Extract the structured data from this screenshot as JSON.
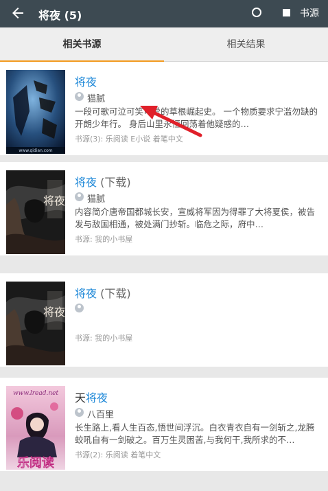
{
  "appbar": {
    "title": "将夜 (5)",
    "source_label": "书源"
  },
  "tabs": [
    {
      "label": "相关书源"
    },
    {
      "label": "相关结果"
    }
  ],
  "books": [
    {
      "name_prefix": "",
      "name_highlight": "将夜",
      "name_suffix": "",
      "author": "猫腻",
      "intro": "一段可歌可泣可笑可爱的草根崛起史。 一个物质要求宁滥勿缺的开朗少年行。 身后山里永恒回荡着他疑惑的…",
      "meta": "书源(3): 乐阅读 E小说 着笔中文",
      "cover_text": "www.qidian.com"
    },
    {
      "name_prefix": "",
      "name_highlight": "将夜",
      "name_suffix": " (下载)",
      "author": "猫腻",
      "intro": "内容简介唐帝国都城长安，宣威将军因为得罪了大将夏侯，被告发与敌国相通，被处满门抄斩。临危之际，府中…",
      "meta": "书源: 我的小书屋",
      "cover_text": "将夜"
    },
    {
      "name_prefix": "",
      "name_highlight": "将夜",
      "name_suffix": " (下载)",
      "author": "",
      "intro": "",
      "meta": "书源: 我的小书屋",
      "cover_text": "将夜"
    },
    {
      "name_prefix": "天",
      "name_highlight": "将夜",
      "name_suffix": "",
      "author": "八百里",
      "intro": "长生路上,看人生百态,悟世间浮沉。白衣青衣自有一剑斩之,龙腾蛟吼自有一剑破之。百万生灵困苦,与我何干,我所求的不…",
      "meta": "书源(2): 乐阅读 着笔中文",
      "cover_text": "乐阅读",
      "cover_url_text": "www.lread.net"
    }
  ],
  "colors": {
    "appbar": "#3d4a52",
    "accent": "#f39a1f",
    "link": "#1e88d8",
    "arrow": "#e0202a"
  }
}
